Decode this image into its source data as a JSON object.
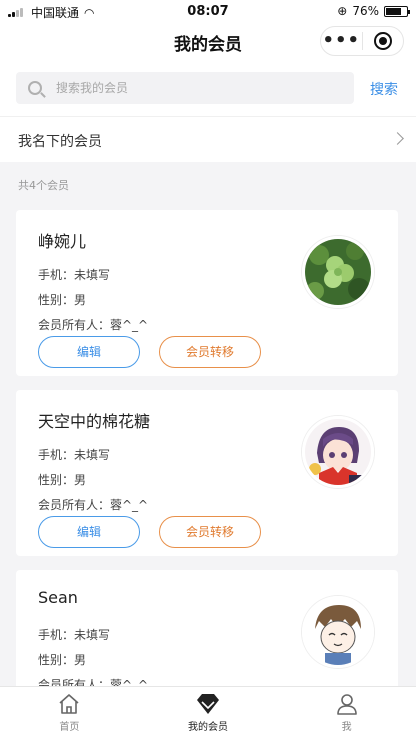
{
  "status_bar": {
    "carrier": "中国联通",
    "time": "08:07",
    "battery": "76%",
    "battery_level": 0.76
  },
  "nav": {
    "title": "我的会员"
  },
  "search": {
    "placeholder": "搜索我的会员",
    "button": "搜索"
  },
  "mine_row": {
    "label": "我名下的会员"
  },
  "summary": {
    "count_text": "共4个会员"
  },
  "members": [
    {
      "name": "峥婉儿",
      "phone": "手机：未填写",
      "gender": "性别：男",
      "owner": "会员所有人：蓉^_^",
      "avatar": "clover-avatar"
    },
    {
      "name": "天空中的棉花糖",
      "phone": "手机：未填写",
      "gender": "性别：男",
      "owner": "会员所有人：蓉^_^",
      "avatar": "anime-girl-avatar"
    },
    {
      "name": "Sean",
      "phone": "手机：未填写",
      "gender": "性别：男",
      "owner": "会员所有人：蓉^_^",
      "avatar": "cartoon-boy-avatar"
    }
  ],
  "buttons": {
    "edit": "编辑",
    "transfer": "会员转移"
  },
  "tabs": [
    {
      "label": "首页",
      "icon": "home-icon"
    },
    {
      "label": "我的会员",
      "icon": "diamond-icon",
      "active": true
    },
    {
      "label": "我",
      "icon": "person-icon"
    }
  ],
  "colors": {
    "accent_blue": "#3a8ee6",
    "accent_orange": "#e07a2e"
  }
}
